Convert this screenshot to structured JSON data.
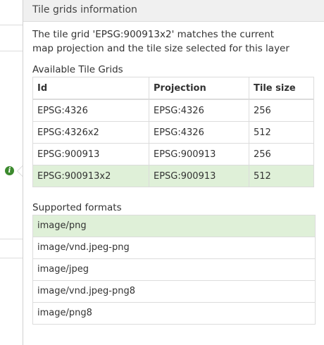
{
  "popover": {
    "title": "Tile grids information",
    "message": "The tile grid 'EPSG:900913x2' matches the current map projection and the tile size selected for this layer",
    "grids_label": "Available Tile Grids",
    "grid_headers": [
      "Id",
      "Projection",
      "Tile size"
    ],
    "grids": [
      {
        "id": "EPSG:4326",
        "projection": "EPSG:4326",
        "tile_size": "256",
        "selected": false
      },
      {
        "id": "EPSG:4326x2",
        "projection": "EPSG:4326",
        "tile_size": "512",
        "selected": false
      },
      {
        "id": "EPSG:900913",
        "projection": "EPSG:900913",
        "tile_size": "256",
        "selected": false
      },
      {
        "id": "EPSG:900913x2",
        "projection": "EPSG:900913",
        "tile_size": "512",
        "selected": true
      }
    ],
    "formats_label": "Supported formats",
    "formats": [
      {
        "name": "image/png",
        "selected": true
      },
      {
        "name": "image/vnd.jpeg-png",
        "selected": false
      },
      {
        "name": "image/jpeg",
        "selected": false
      },
      {
        "name": "image/vnd.jpeg-png8",
        "selected": false
      },
      {
        "name": "image/png8",
        "selected": false
      }
    ]
  },
  "info_icon": {
    "icon": "info-icon",
    "glyph": "i",
    "color": "#3c8a2e"
  },
  "colors": {
    "selected_row": "#dff0d8",
    "header_bg": "#f0f0f0",
    "border": "#dcdcdc"
  }
}
